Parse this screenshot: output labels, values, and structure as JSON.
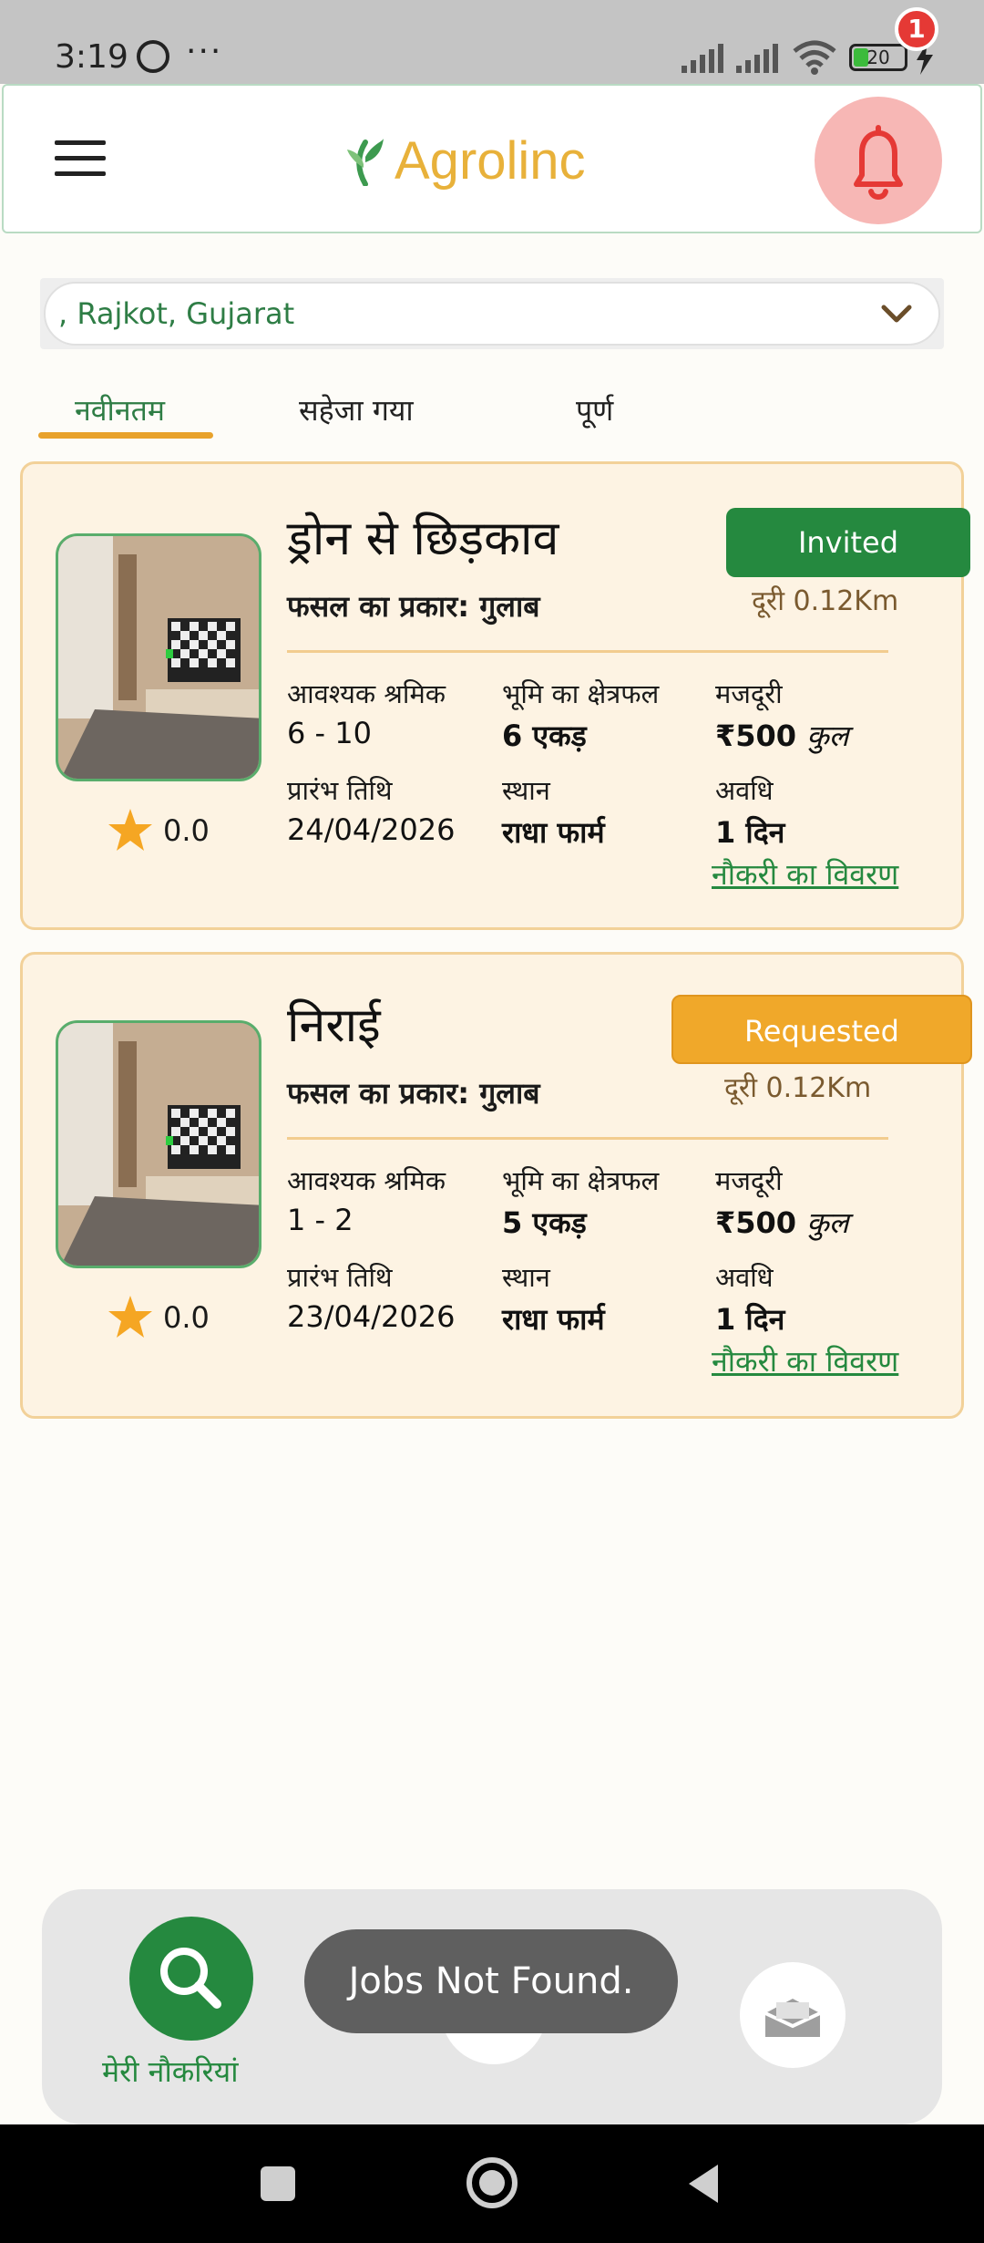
{
  "status_bar": {
    "time": "3:19",
    "dots": "···",
    "battery": "20",
    "icons": [
      "whatsapp-icon",
      "signal-icon",
      "signal-icon",
      "wifi-icon",
      "battery-icon",
      "charging-icon"
    ]
  },
  "header": {
    "app_name": "Agrolinc",
    "notification_count": "1",
    "icons": [
      "menu-icon",
      "logo-leaf-icon",
      "bell-icon"
    ],
    "colors": {
      "logo": "#e8b13a",
      "leaf": "#3d9a4f",
      "bell": "#e53935"
    }
  },
  "location": {
    "value": ", Rajkot, Gujarat"
  },
  "tabs": [
    {
      "label": "नवीनतम",
      "active": true
    },
    {
      "label": "सहेजा गया",
      "active": false
    },
    {
      "label": "पूर्ण",
      "active": false
    }
  ],
  "jobs": [
    {
      "title": "ड्रोन से छिड़काव",
      "crop": "फसल का प्रकार: गुलाब",
      "status": "Invited",
      "distance": "दूरी 0.12Km",
      "rating": "0.0",
      "workers_label": "आवश्यक श्रमिक",
      "workers_value": "6 - 10",
      "area_label": "भूमि का क्षेत्रफल",
      "area_value": "6 एकड़",
      "wage_label": "मजदूरी",
      "wage_value": "₹500",
      "wage_unit": "कुल",
      "start_label": "प्रारंभ तिथि",
      "start_value": "24/04/2026",
      "place_label": "स्थान",
      "place_value": "राधा फार्म",
      "duration_label": "अवधि",
      "duration_value": "1 दिन",
      "details_link": "नौकरी का विवरण"
    },
    {
      "title": "निराई",
      "crop": "फसल का प्रकार: गुलाब",
      "status": "Requested",
      "distance": "दूरी 0.12Km",
      "rating": "0.0",
      "workers_label": "आवश्यक श्रमिक",
      "workers_value": "1 - 2",
      "area_label": "भूमि का क्षेत्रफल",
      "area_value": "5 एकड़",
      "wage_label": "मजदूरी",
      "wage_value": "₹500",
      "wage_unit": "कुल",
      "start_label": "प्रारंभ तिथि",
      "start_value": "23/04/2026",
      "place_label": "स्थान",
      "place_value": "राधा फार्म",
      "duration_label": "अवधि",
      "duration_value": "1 दिन",
      "details_link": "नौकरी का विवरण"
    }
  ],
  "bottom_nav": {
    "my_jobs_label": "मेरी नौकरियां",
    "icons": [
      "search-icon",
      "inbox-icon"
    ]
  },
  "toast": "Jobs Not Found.",
  "colors": {
    "primary_green": "#25893f",
    "accent_orange": "#f0a82a",
    "card_bg": "#fdf3e3",
    "card_border": "#f2d199"
  }
}
